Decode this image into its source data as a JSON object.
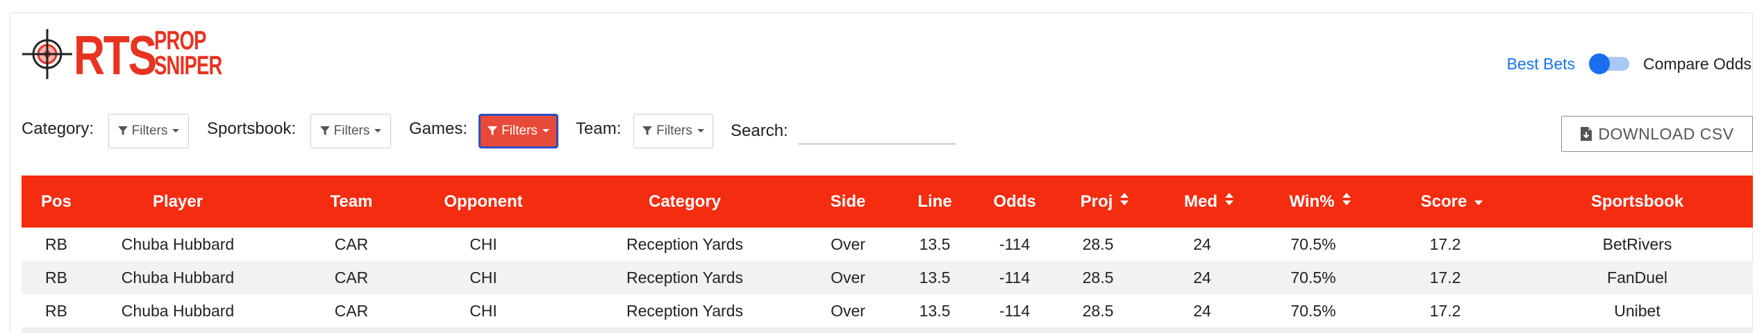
{
  "brand": {
    "logo_main": "RTS",
    "logo_line1": "PROP",
    "logo_line2": "SNIPER",
    "color": "#e83321",
    "logo_icon": "crosshair-icon"
  },
  "view_toggle": {
    "left_label": "Best Bets",
    "right_label": "Compare Odds",
    "state": "Best Bets"
  },
  "filters": [
    {
      "label": "Category:",
      "button": "Filters",
      "active": false
    },
    {
      "label": "Sportsbook:",
      "button": "Filters",
      "active": false
    },
    {
      "label": "Games:",
      "button": "Filters",
      "active": true
    },
    {
      "label": "Team:",
      "button": "Filters",
      "active": false
    }
  ],
  "search": {
    "label": "Search:",
    "value": "",
    "placeholder": ""
  },
  "download": {
    "label": "DOWNLOAD CSV",
    "icon": "file-download-icon"
  },
  "table": {
    "header_color": "#f42c10",
    "columns": [
      {
        "label": "Pos",
        "sort": ""
      },
      {
        "label": "Player",
        "sort": ""
      },
      {
        "label": "Team",
        "sort": ""
      },
      {
        "label": "Opponent",
        "sort": ""
      },
      {
        "label": "Category",
        "sort": ""
      },
      {
        "label": "Side",
        "sort": ""
      },
      {
        "label": "Line",
        "sort": ""
      },
      {
        "label": "Odds",
        "sort": ""
      },
      {
        "label": "Proj",
        "sort": "both"
      },
      {
        "label": "Med",
        "sort": "both"
      },
      {
        "label": "Win%",
        "sort": "both"
      },
      {
        "label": "Score",
        "sort": "desc"
      },
      {
        "label": "Sportsbook",
        "sort": ""
      }
    ],
    "rows": [
      [
        "RB",
        "Chuba Hubbard",
        "CAR",
        "CHI",
        "Reception Yards",
        "Over",
        "13.5",
        "-114",
        "28.5",
        "24",
        "70.5%",
        "17.2",
        "BetRivers"
      ],
      [
        "RB",
        "Chuba Hubbard",
        "CAR",
        "CHI",
        "Reception Yards",
        "Over",
        "13.5",
        "-114",
        "28.5",
        "24",
        "70.5%",
        "17.2",
        "FanDuel"
      ],
      [
        "RB",
        "Chuba Hubbard",
        "CAR",
        "CHI",
        "Reception Yards",
        "Over",
        "13.5",
        "-114",
        "28.5",
        "24",
        "70.5%",
        "17.2",
        "Unibet"
      ]
    ]
  }
}
